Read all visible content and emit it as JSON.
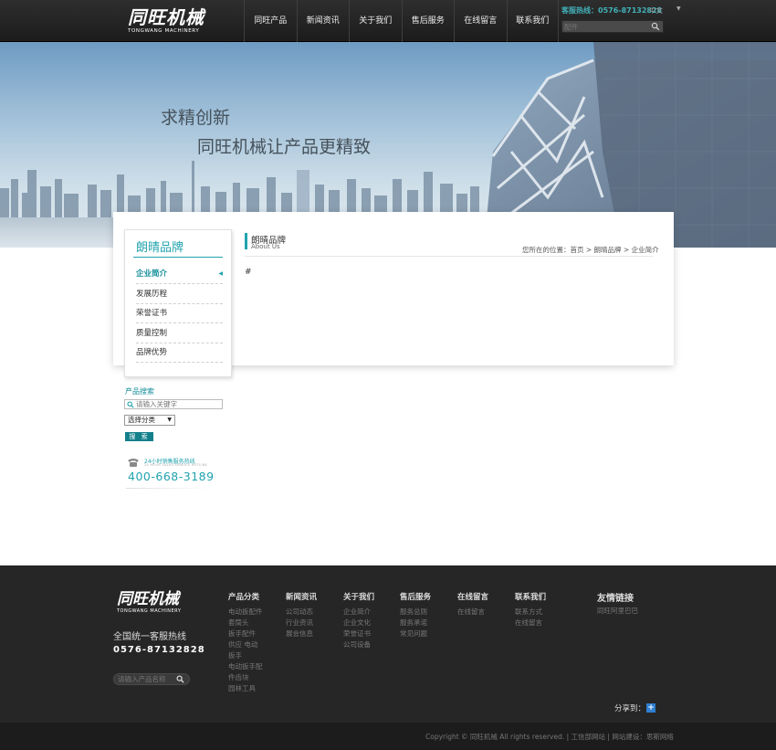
{
  "header": {
    "logo_cn": "同旺机械",
    "logo_en": "TONGWANG MACHINERY",
    "nav": [
      "同旺产品",
      "新闻资讯",
      "关于我们",
      "售后服务",
      "在线留言",
      "联系我们"
    ],
    "hotline": "客服热线：0576-87132828",
    "language": "中文",
    "search_placeholder": "配件"
  },
  "banner": {
    "slogan_line1": "求精创新",
    "slogan_line2": "同旺机械让产品更精致"
  },
  "sidebar": {
    "title": "朗晴品牌",
    "items": [
      {
        "label": "企业简介",
        "active": true
      },
      {
        "label": "发展历程",
        "active": false
      },
      {
        "label": "荣誉证书",
        "active": false
      },
      {
        "label": "质量控制",
        "active": false
      },
      {
        "label": "品牌优势",
        "active": false
      }
    ]
  },
  "content": {
    "title": "朗晴品牌",
    "subtitle": "About Us",
    "breadcrumb": "您所在的位置：首页 > 朗晴品牌 > 企业简介",
    "body": "#"
  },
  "product_search": {
    "title": "产品搜索",
    "placeholder": "请输入关键字",
    "category_select": "选择分类",
    "button": "搜 索"
  },
  "hotline_box": {
    "label": "24小时销售服务热线",
    "label_small": "24 HOUR SALES SERVICE HOTLINE",
    "number": "400-668-3189"
  },
  "footer": {
    "logo_cn": "同旺机械",
    "logo_en": "TONGWANG MACHINERY",
    "hotline_label": "全国统一客服热线",
    "hotline_number": "0576-87132828",
    "search_placeholder": "请输入产品名称",
    "columns": [
      {
        "heading": "产品分类",
        "links": [
          "电动扳配件",
          "套筒头",
          "扳手配件",
          "供应 电动",
          "扳手",
          "电动扳手配",
          "件齿块",
          "园林工具"
        ]
      },
      {
        "heading": "新闻资讯",
        "links": [
          "公司动态",
          "行业资讯",
          "展会信息"
        ]
      },
      {
        "heading": "关于我们",
        "links": [
          "企业简介",
          "企业文化",
          "荣誉证书",
          "公司设备"
        ]
      },
      {
        "heading": "售后服务",
        "links": [
          "服务总则",
          "服务承诺",
          "常见问题"
        ]
      },
      {
        "heading": "在线留言",
        "links": [
          "在线留言"
        ]
      },
      {
        "heading": "联系我们",
        "links": [
          "联系方式",
          "在线留言"
        ]
      }
    ],
    "friend_links_heading": "友情链接",
    "friend_links": [
      "同旺阿里巴巴"
    ],
    "share_label": "分享到：",
    "share_button": "+",
    "copyright": "Copyright © 同旺机械 All rights reserved. | 工信部网站 | 网站建设：思斯网络"
  },
  "colors": {
    "accent": "#21a3ae",
    "header_bg": "#262626",
    "footer_bg": "#262626"
  }
}
